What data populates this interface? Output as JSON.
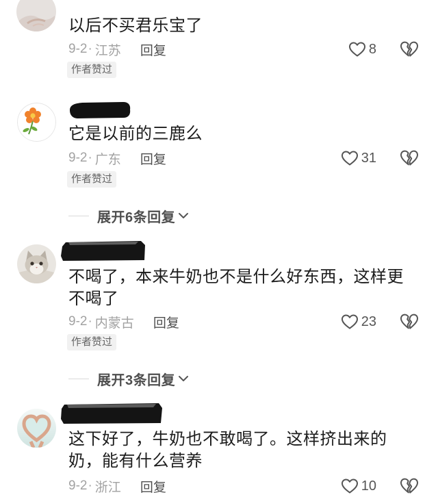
{
  "meta_separator": "·",
  "reply_label": "回复",
  "comments": [
    {
      "lines": [
        "以后不买君乐宝了"
      ],
      "date": "9-2",
      "location": "江苏",
      "likes": "8",
      "badge": "作者赞过"
    },
    {
      "lines": [
        "它是以前的三鹿么"
      ],
      "date": "9-2",
      "location": "广东",
      "likes": "31",
      "badge": "作者赞过"
    },
    {
      "lines": [
        "不喝了，本来牛奶也不是什么好东西，这样更",
        "不喝了"
      ],
      "date": "9-2",
      "location": "内蒙古",
      "likes": "23",
      "badge": "作者赞过"
    },
    {
      "lines": [
        "这下好了，牛奶也不敢喝了。这样挤出来的",
        "奶，能有什么营养"
      ],
      "date": "9-2",
      "location": "浙江",
      "likes": "10"
    }
  ],
  "expand_replies": [
    {
      "label": "展开6条回复"
    },
    {
      "label": "展开3条回复"
    }
  ],
  "icons": {
    "like": "heart-icon",
    "dislike": "broken-heart-icon",
    "expand": "chevron-down-icon"
  },
  "colors": {
    "text": "#1c1c1c",
    "meta": "#a2a2a2",
    "reply": "#4f4f4f",
    "icon": "#555555",
    "badge_bg": "#f1f1f1"
  }
}
